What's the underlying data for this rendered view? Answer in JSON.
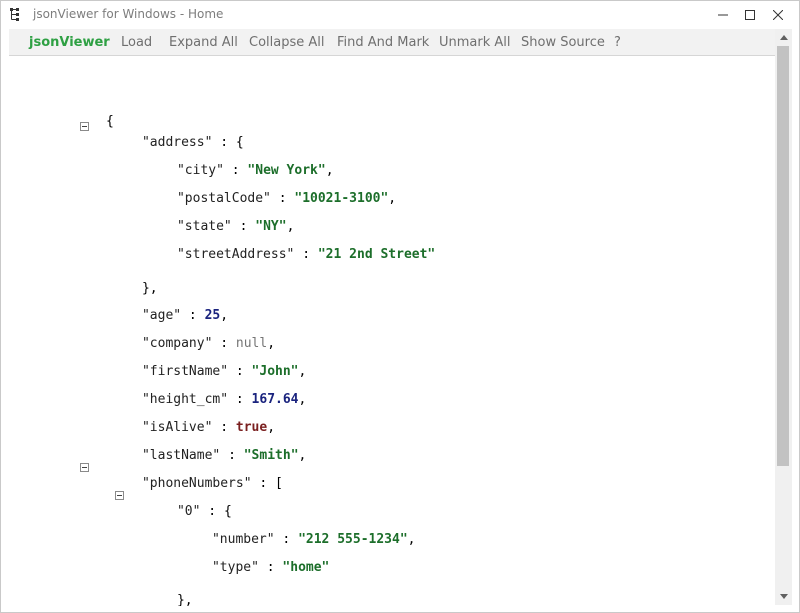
{
  "window": {
    "title": "jsonViewer for Windows - Home"
  },
  "menu": {
    "brand": "jsonViewer",
    "items": [
      "Load",
      "Expand All",
      "Collapse All",
      "Find And Mark",
      "Unmark All",
      "Show Source",
      "?"
    ]
  },
  "json": {
    "open_root": "{",
    "address_key": "\"address\"",
    "address_open": "{",
    "city_key": "\"city\"",
    "city_val": "\"New York\"",
    "postal_key": "\"postalCode\"",
    "postal_val": "\"10021-3100\"",
    "state_key": "\"state\"",
    "state_val": "\"NY\"",
    "street_key": "\"streetAddress\"",
    "street_val": "\"21 2nd Street\"",
    "address_close": "},",
    "age_key": "\"age\"",
    "age_val": "25",
    "company_key": "\"company\"",
    "company_val": "null",
    "firstname_key": "\"firstName\"",
    "firstname_val": "\"John\"",
    "height_key": "\"height_cm\"",
    "height_val": "167.64",
    "isalive_key": "\"isAlive\"",
    "isalive_val": "true",
    "lastname_key": "\"lastName\"",
    "lastname_val": "\"Smith\"",
    "phones_key": "\"phoneNumbers\"",
    "phones_open": "[",
    "phone0_key": "\"0\"",
    "phone0_open": "{",
    "number_key": "\"number\"",
    "number_val": "\"212 555-1234\"",
    "type_key": "\"type\"",
    "type_val": "\"home\"",
    "phone0_close": "},"
  },
  "colors": {
    "brand": "#2ea043",
    "string": "#1c6e2a",
    "number": "#1a237e",
    "boolean": "#7a1f1f",
    "null": "#757575"
  }
}
